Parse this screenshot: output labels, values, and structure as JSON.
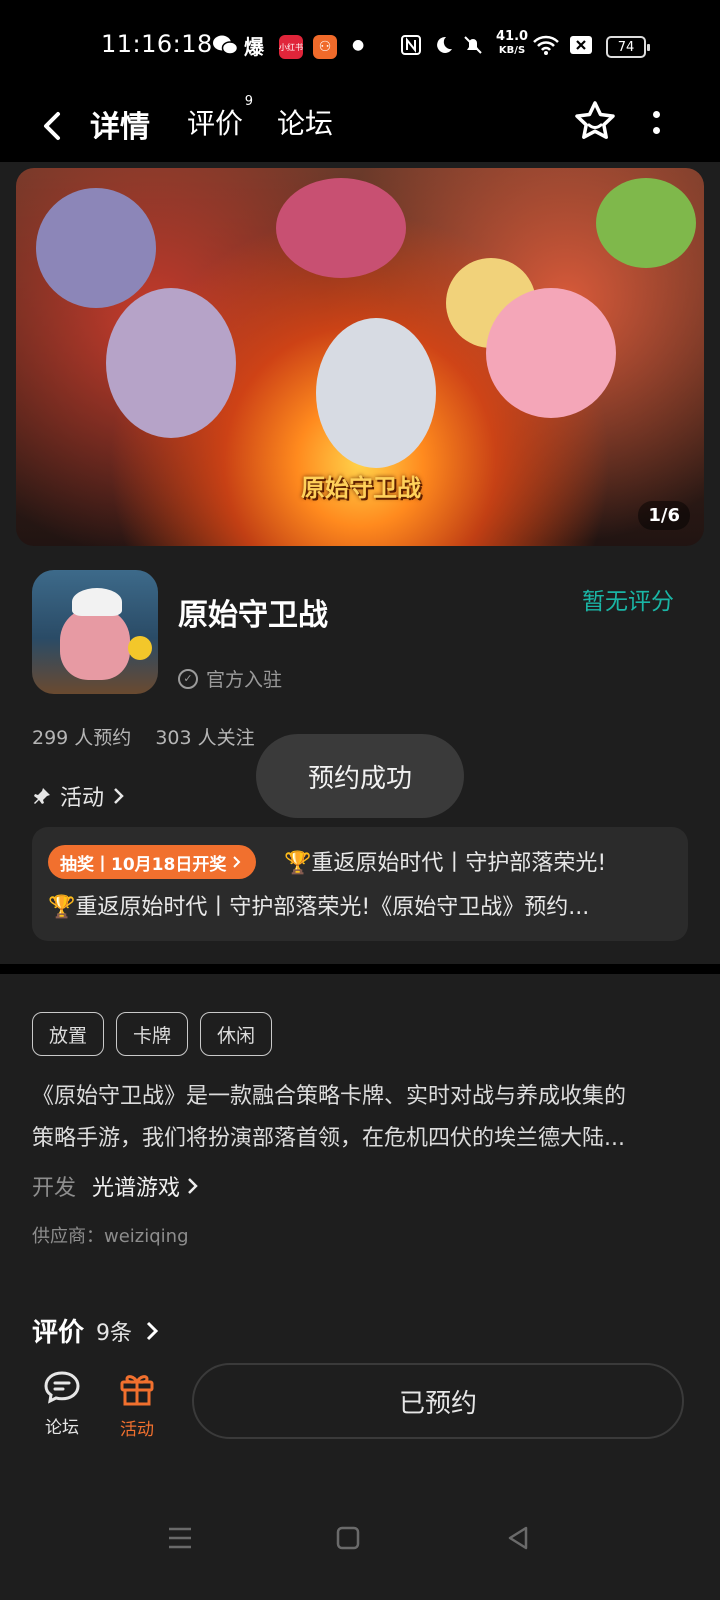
{
  "status_bar": {
    "time": "11:16:18",
    "speed_value": "41.0",
    "speed_unit": "KB/S",
    "battery": "74",
    "app_badge_1": "小红书"
  },
  "header": {
    "tabs": [
      {
        "label": "详情",
        "active": true
      },
      {
        "label": "评价",
        "badge": "9"
      },
      {
        "label": "论坛"
      }
    ]
  },
  "banner": {
    "logo_text": "原始守卫战",
    "counter": "1/6"
  },
  "app": {
    "title": "原始守卫战",
    "official_label": "官方入驻",
    "rating": "暂无评分",
    "reservations": "299 人预约",
    "followers": "303 人关注"
  },
  "activity": {
    "link_label": "活动",
    "tag": "抽奖丨10月18日开奖",
    "line1": "重返原始时代丨守护部落荣光!",
    "line2": "重返原始时代丨守护部落荣光!《原始守卫战》预约..."
  },
  "toast": "预约成功",
  "tags": [
    "放置",
    "卡牌",
    "休闲"
  ],
  "description": {
    "line1": "《原始守卫战》是一款融合策略卡牌、实时对战与养成收集的",
    "line2": "策略手游，我们将扮演部落首领，在危机四伏的埃兰德大陆..."
  },
  "developer": {
    "label": "开发",
    "value": "光谱游戏"
  },
  "supplier": "供应商：weiziqing",
  "reviews": {
    "title": "评价",
    "count": "9条"
  },
  "bottom": {
    "forum_label": "论坛",
    "activity_label": "活动",
    "reserve_button": "已预约"
  },
  "colors": {
    "accent": "#1ab5a5",
    "activity_orange": "#f1702e",
    "background": "#1e1e1e"
  }
}
